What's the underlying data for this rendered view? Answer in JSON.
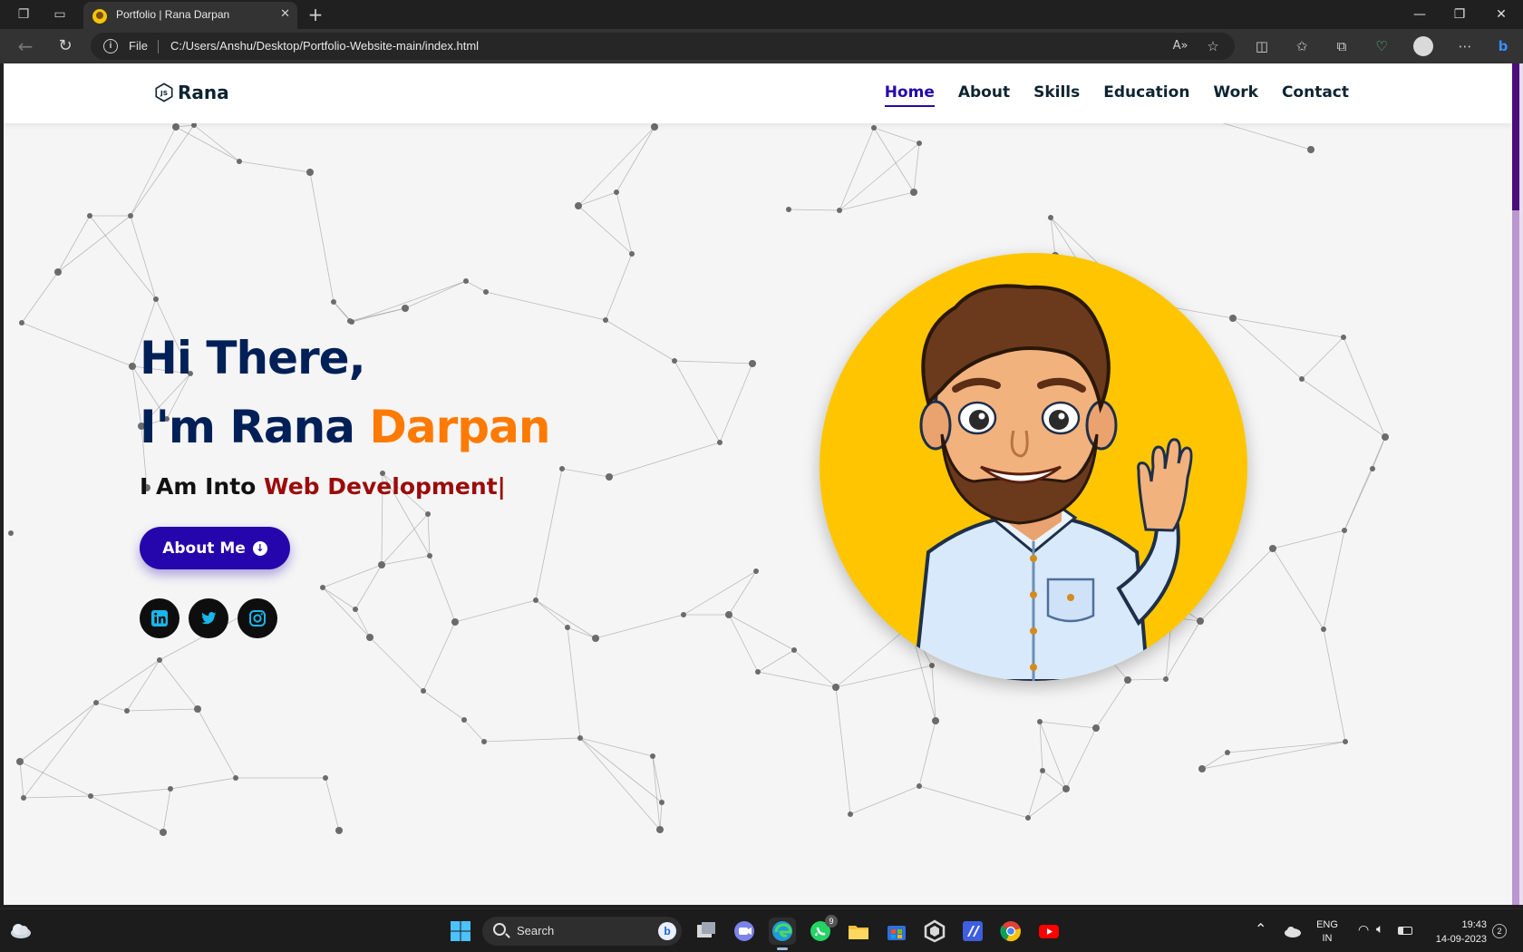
{
  "browser": {
    "tab_title": "Portfolio | Rana Darpan",
    "file_label": "File",
    "url": "C:/Users/Anshu/Desktop/Portfolio-Website-main/index.html"
  },
  "site": {
    "logo_text": "Rana",
    "nav": [
      {
        "label": "Home",
        "active": true
      },
      {
        "label": "About",
        "active": false
      },
      {
        "label": "Skills",
        "active": false
      },
      {
        "label": "Education",
        "active": false
      },
      {
        "label": "Work",
        "active": false
      },
      {
        "label": "Contact",
        "active": false
      }
    ],
    "hero": {
      "greeting": "Hi There,",
      "intro_prefix": "I'm Rana ",
      "intro_highlight": "Darpan",
      "tagline_prefix": "I Am Into ",
      "tagline_highlight": "Web Development|",
      "button_label": "About Me"
    },
    "social": [
      "linkedin-icon",
      "twitter-icon",
      "instagram-icon"
    ],
    "colors": {
      "primary": "#2506ad",
      "heading": "#002057",
      "accent_orange": "#ff7a00",
      "accent_red": "#9b0b0b",
      "avatar_bg": "#ffc600"
    }
  },
  "taskbar": {
    "search_label": "Search",
    "whatsapp_badge": "9",
    "language": "ENG",
    "region": "IN",
    "time": "19:43",
    "date": "14-09-2023",
    "notification_count": "2"
  }
}
